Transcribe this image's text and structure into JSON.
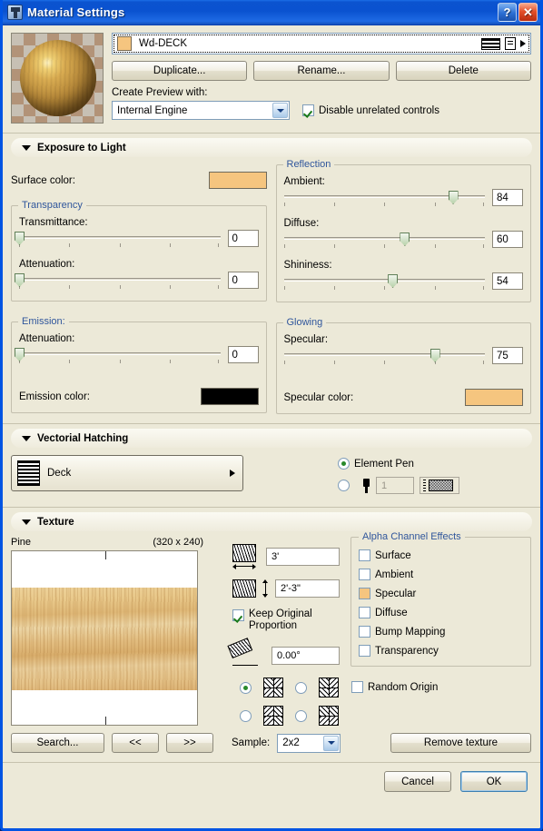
{
  "window": {
    "title": "Material Settings",
    "icon": "material-icon",
    "help_button": "?",
    "close_button": "✕"
  },
  "material": {
    "preview_alt": "material-sphere-preview",
    "name": "Wd-DECK",
    "swatch_color": "#f5c57f",
    "buttons": {
      "duplicate": "Duplicate...",
      "rename": "Rename...",
      "delete": "Delete"
    },
    "create_preview_label": "Create Preview with:",
    "engine_value": "Internal Engine",
    "engine_options": [
      "Internal Engine"
    ],
    "disable_unrelated": {
      "label": "Disable unrelated controls",
      "checked": true
    }
  },
  "sections": {
    "exposure": "Exposure to Light",
    "hatching": "Vectorial Hatching",
    "texture": "Texture"
  },
  "exposure": {
    "surface_color_label": "Surface color:",
    "surface_color": "#f5c57f",
    "transparency": {
      "legend": "Transparency",
      "fields": [
        {
          "label": "Transmittance:",
          "value": "0",
          "percent": 0
        },
        {
          "label": "Attenuation:",
          "value": "0",
          "percent": 0
        }
      ]
    },
    "reflection": {
      "legend": "Reflection",
      "fields": [
        {
          "label": "Ambient:",
          "value": "84",
          "percent": 84
        },
        {
          "label": "Diffuse:",
          "value": "60",
          "percent": 60
        },
        {
          "label": "Shininess:",
          "value": "54",
          "percent": 54
        }
      ]
    },
    "emission": {
      "legend": "Emission:",
      "fields": [
        {
          "label": "Attenuation:",
          "value": "0",
          "percent": 0
        }
      ],
      "color_label": "Emission color:",
      "color": "#000000"
    },
    "glowing": {
      "legend": "Glowing",
      "fields": [
        {
          "label": "Specular:",
          "value": "75",
          "percent": 75
        }
      ],
      "color_label": "Specular color:",
      "color": "#f5c57f"
    }
  },
  "hatching": {
    "pattern_name": "Deck",
    "element_pen": {
      "label": "Element Pen",
      "selected": true
    },
    "custom_pen": {
      "selected": false,
      "pen_number": "1"
    }
  },
  "texture": {
    "name": "Pine",
    "dimensions": "(320 x 240)",
    "width_value": "3'",
    "height_value": "2'-3\"",
    "keep_proportion": {
      "label": "Keep Original Proportion",
      "checked": true
    },
    "angle_value": "0.00°",
    "mirror_modes": [
      {
        "id": "mirror-none",
        "selected": true
      },
      {
        "id": "mirror-horizontal",
        "selected": false
      },
      {
        "id": "mirror-vertical",
        "selected": false
      },
      {
        "id": "mirror-both",
        "selected": false
      }
    ],
    "alpha": {
      "legend": "Alpha Channel Effects",
      "items": [
        {
          "label": "Surface",
          "checked": false,
          "tinted": false
        },
        {
          "label": "Ambient",
          "checked": false,
          "tinted": false
        },
        {
          "label": "Specular",
          "checked": false,
          "tinted": true
        },
        {
          "label": "Diffuse",
          "checked": false,
          "tinted": false
        },
        {
          "label": "Bump Mapping",
          "checked": false,
          "tinted": false
        },
        {
          "label": "Transparency",
          "checked": false,
          "tinted": false
        }
      ]
    },
    "random_origin": {
      "label": "Random Origin",
      "checked": false
    },
    "search_button": "Search...",
    "prev_button": "<<",
    "next_button": ">>",
    "sample_label": "Sample:",
    "sample_value": "2x2",
    "sample_options": [
      "2x2"
    ],
    "remove_button": "Remove texture"
  },
  "footer": {
    "cancel": "Cancel",
    "ok": "OK"
  }
}
